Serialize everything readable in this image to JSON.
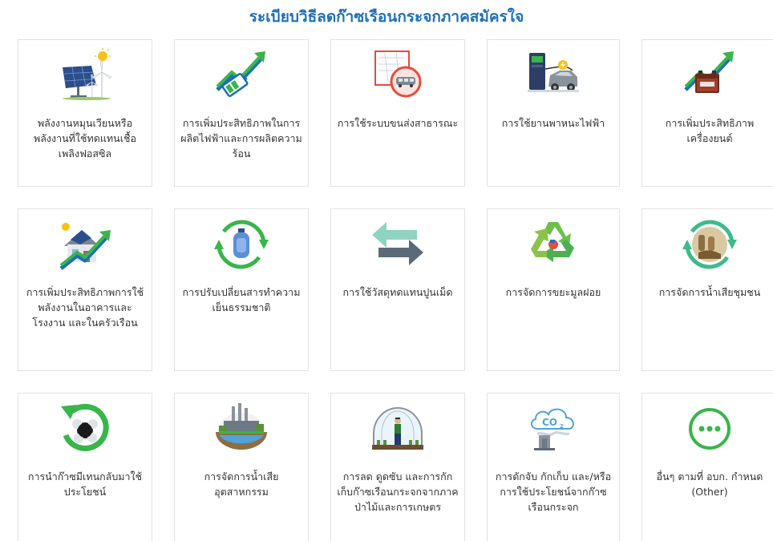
{
  "page": {
    "title": "ระเบียบวิธีลดก๊าซเรือนกระจกภาคสมัครใจ"
  },
  "cards": [
    {
      "label": "พลังงานหมุนเวียนหรือพลังงานที่ใช้ทดแทนเชื้อเพลิงฟอสซิล",
      "icon": "solar-wind-icon"
    },
    {
      "label": "การเพิ่มประสิทธิภาพในการผลิตไฟฟ้าและการผลิตความร้อน",
      "icon": "battery-growth-icon"
    },
    {
      "label": "การใช้ระบบขนส่งสาธารณะ",
      "icon": "public-transport-icon"
    },
    {
      "label": "การใช้ยานพาหนะไฟฟ้า",
      "icon": "electric-vehicle-icon"
    },
    {
      "label": "การเพิ่มประสิทธิภาพเครื่องยนต์",
      "icon": "engine-growth-icon"
    },
    {
      "label": "การเพิ่มประสิทธิภาพการใช้พลังงานในอาคารและโรงงาน และในครัวเรือน",
      "icon": "house-growth-icon"
    },
    {
      "label": "การปรับเปลี่ยนสารทำความเย็นธรรมชาติ",
      "icon": "refrigerant-cycle-icon"
    },
    {
      "label": "การใช้วัสดุทดแทนปูนเม็ด",
      "icon": "swap-arrows-icon"
    },
    {
      "label": "การจัดการขยะมูลฝอย",
      "icon": "recycle-icon"
    },
    {
      "label": "การจัดการน้ำเสียชุมชน",
      "icon": "wastewater-cycle-icon"
    },
    {
      "label": "การนำก๊าซมีเทนกลับมาใช้ประโยชน์",
      "icon": "methane-recovery-icon"
    },
    {
      "label": "การจัดการน้ำเสียอุตสาหกรรม",
      "icon": "industrial-wastewater-icon"
    },
    {
      "label": "การลด ดูดซับ และการกักเก็บก๊าซเรือนกระจกจากภาคป่าไม้และการเกษตร",
      "icon": "greenhouse-farmer-icon"
    },
    {
      "label": "การดักจับ กักเก็บ และ/หรือการใช้ประโยชน์จากก๊าซเรือนกระจก",
      "icon": "co2-cloud-icon"
    },
    {
      "label": "อื่นๆ ตามที่ อบก. กำหนด (Other)",
      "icon": "more-dots-icon"
    }
  ]
}
